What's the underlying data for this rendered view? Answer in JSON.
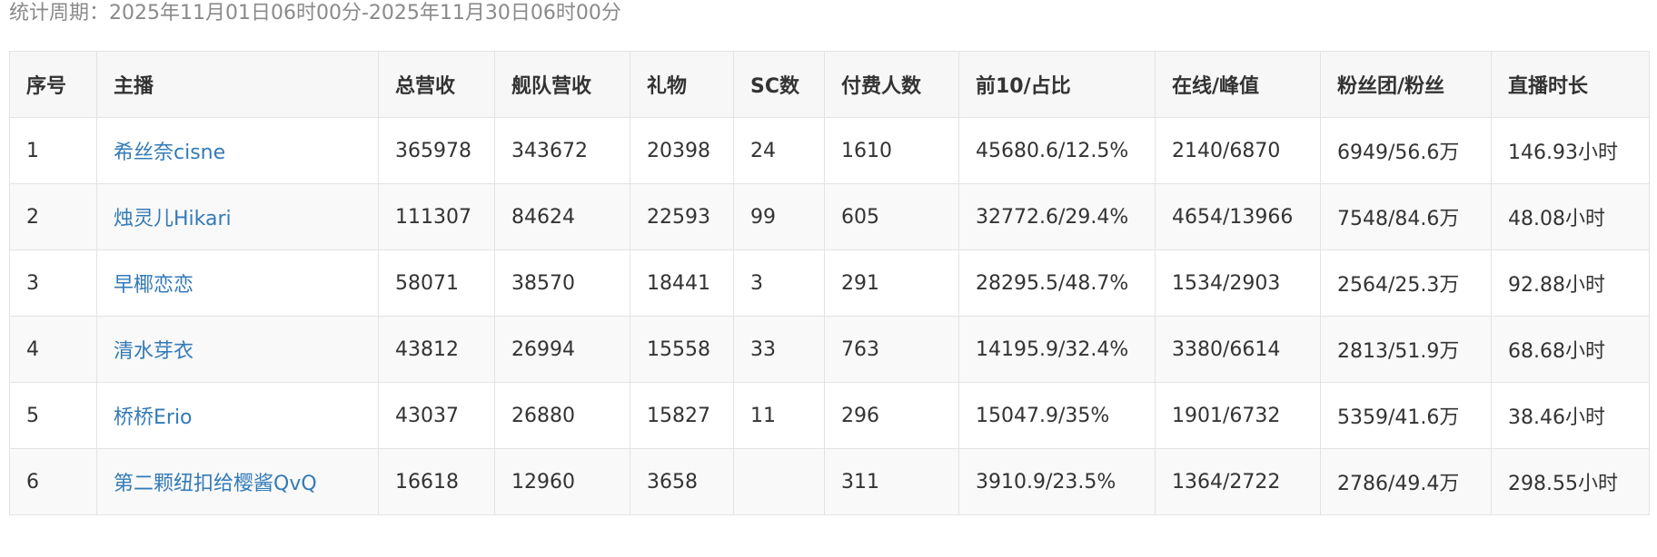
{
  "period_text": "统计周期：2025年11月01日06时00分-2025年11月30日06时00分",
  "colors": {
    "link": "#337ab7",
    "header_bg": "#f7f7f7",
    "border": "#e3e3e3",
    "period_text": "#8a8a8a"
  },
  "table": {
    "headers": [
      "序号",
      "主播",
      "总营收",
      "舰队营收",
      "礼物",
      "SC数",
      "付费人数",
      "前10/占比",
      "在线/峰值",
      "粉丝团/粉丝",
      "直播时长"
    ],
    "rows": [
      [
        "1",
        "希丝奈cisne",
        "365978",
        "343672",
        "20398",
        "24",
        "1610",
        "45680.6/12.5%",
        "2140/6870",
        "6949/56.6万",
        "146.93小时"
      ],
      [
        "2",
        "烛灵儿Hikari",
        "111307",
        "84624",
        "22593",
        "99",
        "605",
        "32772.6/29.4%",
        "4654/13966",
        "7548/84.6万",
        "48.08小时"
      ],
      [
        "3",
        "早椰恋恋",
        "58071",
        "38570",
        "18441",
        "3",
        "291",
        "28295.5/48.7%",
        "1534/2903",
        "2564/25.3万",
        "92.88小时"
      ],
      [
        "4",
        "清水芽衣",
        "43812",
        "26994",
        "15558",
        "33",
        "763",
        "14195.9/32.4%",
        "3380/6614",
        "2813/51.9万",
        "68.68小时"
      ],
      [
        "5",
        "桥桥Erio",
        "43037",
        "26880",
        "15827",
        "11",
        "296",
        "15047.9/35%",
        "1901/6732",
        "5359/41.6万",
        "38.46小时"
      ],
      [
        "6",
        "第二颗纽扣给樱酱QvQ",
        "16618",
        "12960",
        "3658",
        "",
        "311",
        "3910.9/23.5%",
        "1364/2722",
        "2786/49.4万",
        "298.55小时"
      ]
    ]
  }
}
